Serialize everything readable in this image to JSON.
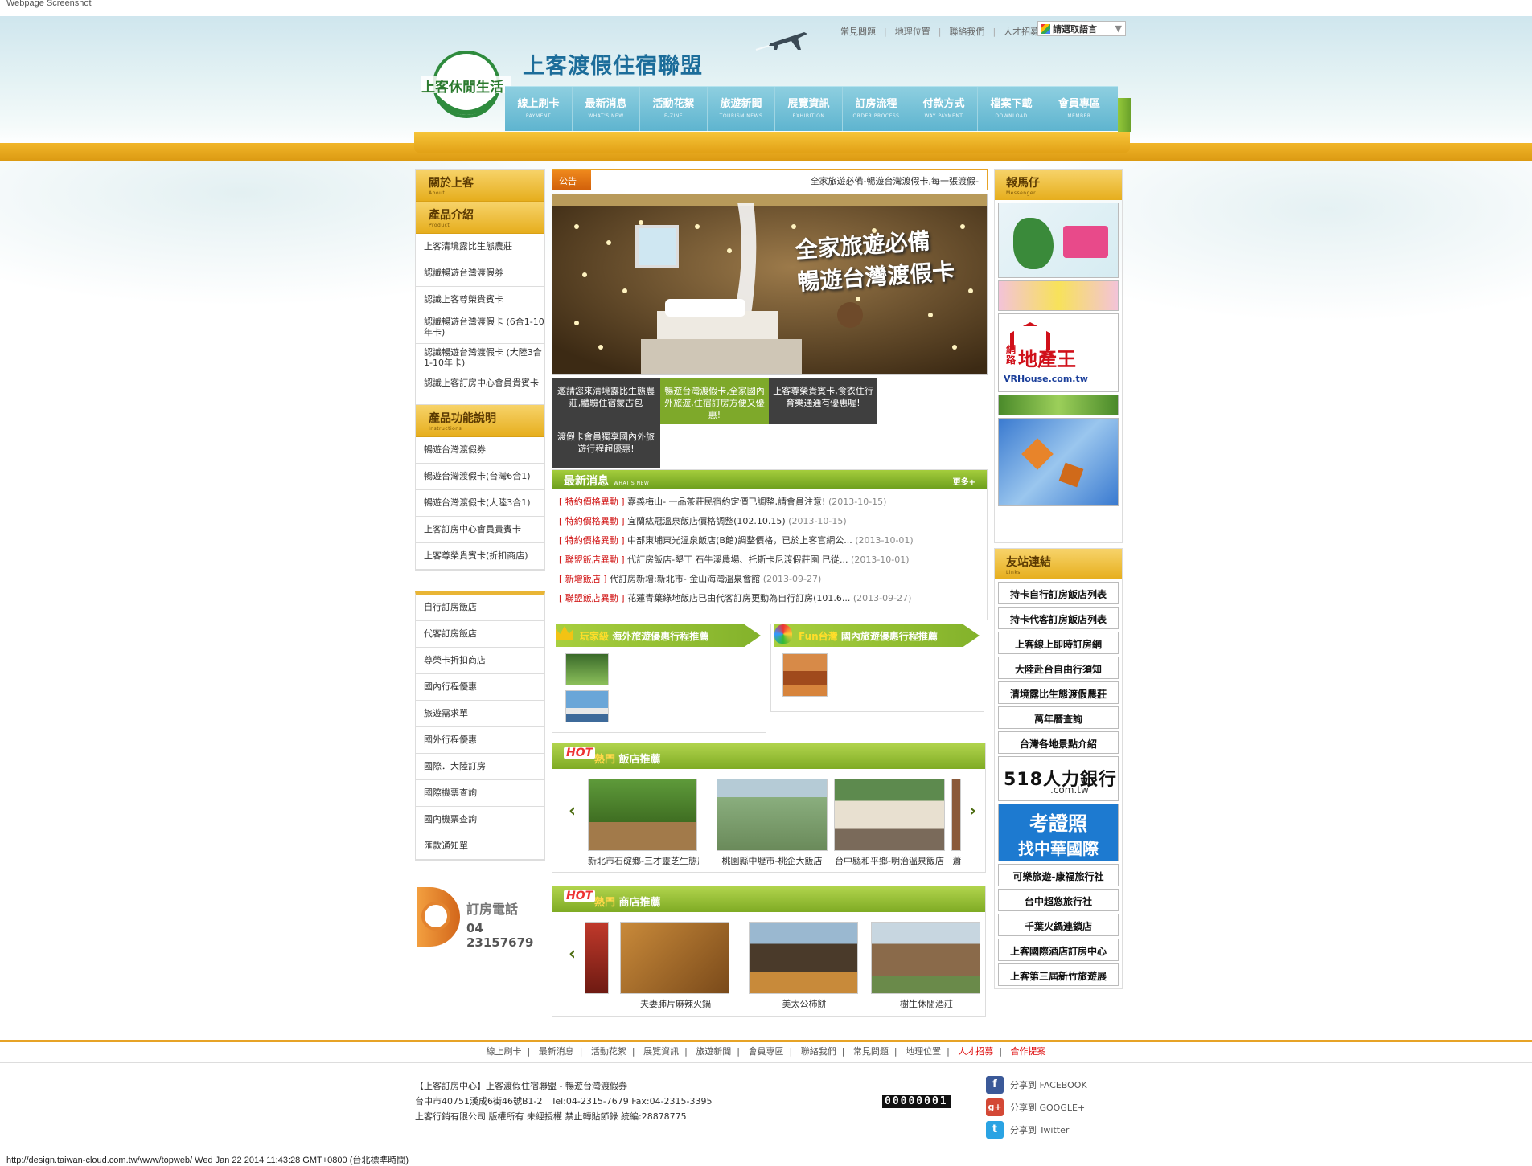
{
  "caption": "Webpage Screenshot",
  "site": {
    "title": "上客渡假住宿聯盟",
    "logo_text": "上客休閒生活"
  },
  "top_links": [
    "常見問題",
    "地理位置",
    "聯絡我們",
    "人才招募"
  ],
  "language_select": "請選取語言",
  "nav": [
    {
      "zh": "線上刷卡",
      "en": "PAYMENT"
    },
    {
      "zh": "最新消息",
      "en": "WHAT'S NEW"
    },
    {
      "zh": "活動花絮",
      "en": "E-ZINE"
    },
    {
      "zh": "旅遊新聞",
      "en": "TOURISM NEWS"
    },
    {
      "zh": "展覽資訊",
      "en": "EXHIBITION"
    },
    {
      "zh": "訂房流程",
      "en": "ORDER PROCESS"
    },
    {
      "zh": "付款方式",
      "en": "WAY PAYMENT"
    },
    {
      "zh": "檔案下載",
      "en": "DOWNLOAD"
    },
    {
      "zh": "會員專區",
      "en": "MEMBER"
    }
  ],
  "left": {
    "about": {
      "zh": "關於上客",
      "en": "About"
    },
    "product": {
      "zh": "產品介紹",
      "en": "Product"
    },
    "product_items": [
      "上客清境露比生態農莊",
      "認識暢遊台灣渡假券",
      "認識上客尊榮貴賓卡",
      "認識暢遊台灣渡假卡 (6合1-10年卡)",
      "認識暢遊台灣渡假卡 (大陸3合1-10年卡)",
      "認識上客訂房中心會員貴賓卡"
    ],
    "instructions": {
      "zh": "產品功能說明",
      "en": "Instructions"
    },
    "instruction_items": [
      "暢遊台灣渡假券",
      "暢遊台灣渡假卡(台灣6合1)",
      "暢遊台灣渡假卡(大陸3合1)",
      "上客訂房中心會員貴賓卡",
      "上客尊榮貴賓卡(折扣商店)"
    ],
    "service_items": [
      "自行訂房飯店",
      "代客訂房飯店",
      "尊榮卡折扣商店",
      "國內行程優惠",
      "旅遊需求單",
      "國外行程優惠",
      "國際．大陸訂房",
      "國際機票查詢",
      "國內機票查詢",
      "匯款通知單"
    ],
    "phone_label": "訂房電話",
    "phone_number": "04 23157679"
  },
  "notice": {
    "tag": "公告",
    "text": "全家旅遊必備-暢遊台灣渡假卡,每一張渡假-"
  },
  "banner": {
    "line1": "全家旅遊必備",
    "line2": "暢遊台灣渡假卡",
    "tiles": [
      "邀請您來清境露比生態農莊,體驗住宿蒙古包",
      "暢遊台灣渡假卡,全家國內外旅遊,住宿訂房方便又優惠!",
      "上客尊榮貴賓卡,食衣住行育樂通通有優惠喔!",
      "渡假卡會員獨享國內外旅遊行程超優惠!"
    ]
  },
  "news": {
    "title": "最新消息",
    "title_en": "WHAT'S NEW",
    "more": "更多+",
    "items": [
      {
        "cat": "[ 特約價格異動 ]",
        "text": "嘉義梅山- 一品茶莊民宿約定價已調整,請會員注意!",
        "date": "(2013-10-15)"
      },
      {
        "cat": "[ 特約價格異動 ]",
        "text": "宜蘭紘冠溫泉飯店價格調整(102.10.15)",
        "date": "(2013-10-15)"
      },
      {
        "cat": "[ 特約價格異動 ]",
        "text": "中部東埔東光溫泉飯店(B館)調整價格，已於上客官網公...",
        "date": "(2013-10-01)"
      },
      {
        "cat": "[ 聯盟飯店異動 ]",
        "text": "代訂房飯店-墾丁 石牛溪農場、托斯卡尼渡假莊園 已從...",
        "date": "(2013-10-01)"
      },
      {
        "cat": "[ 新增飯店 ]",
        "text": "代訂房新增:新北市- 金山海灣溫泉會館",
        "date": "(2013-09-27)"
      },
      {
        "cat": "[ 聯盟飯店異動 ]",
        "text": "花蓮青葉綠地飯店已由代客訂房更動為自行訂房(101.6...",
        "date": "(2013-09-27)"
      }
    ]
  },
  "promo_left": {
    "badge": "玩家級",
    "title": "海外旅遊優惠行程推薦"
  },
  "promo_right": {
    "badge": "Fun台灣",
    "title": "國內旅遊優惠行程推薦"
  },
  "hot_hotels": {
    "badge": "HOT",
    "hot": "熱門",
    "title": "飯店推薦",
    "items": [
      "新北市石碇鄉-三才靈芝生態農場",
      "桃園縣中壢市-桃企大飯店",
      "台中縣和平鄉-明治溫泉飯店",
      "蕭"
    ]
  },
  "hot_shops": {
    "badge": "HOT",
    "hot": "熱門",
    "title": "商店推薦",
    "items": [
      "夫妻肺片麻辣火鍋",
      "美太公柿餅",
      "樹生休閒酒莊"
    ]
  },
  "right": {
    "messenger": {
      "zh": "報馬仔",
      "en": "Messenger"
    },
    "links_head": {
      "zh": "友站連結",
      "en": "Links"
    },
    "links_a": [
      "持卡自行訂房飯店列表",
      "持卡代客訂房飯店列表",
      "上客線上即時訂房網",
      "大陸赴台自由行須知",
      "清境露比生態渡假農莊",
      "萬年曆查詢",
      "台灣各地景點介紹"
    ],
    "ad_518": "518人力銀行",
    "ad_518_url": ".com.tw",
    "ad_exam_line1": "考證照",
    "ad_exam_line2": "找中華國際",
    "ad_house_line1": "網路",
    "ad_house_line2": "地產王",
    "ad_house_url": "VRHouse.com.tw",
    "links_b": [
      "可樂旅遊-康福旅行社",
      "台中超悠旅行社",
      "千葉火鍋連鎖店",
      "上客國際酒店訂房中心",
      "上客第三屆新竹旅遊展"
    ]
  },
  "footer": {
    "nav": [
      "線上刷卡",
      "最新消息",
      "活動花絮",
      "展覽資訊",
      "旅遊新聞",
      "會員專區",
      "聯絡我們",
      "常見問題",
      "地理位置"
    ],
    "nav_red": [
      "人才招募",
      "合作提案"
    ],
    "info1": "【上客訂房中心】上客渡假住宿聯盟 - 暢遊台灣渡假券",
    "info2": "台中市40751漢成6街46號B1-2　Tel:04-2315-7679 Fax:04-2315-3395",
    "info3": "上客行銷有限公司 版權所有 未經授權 禁止轉貼節錄 統編:28878775",
    "counter": "00000001",
    "share": [
      "分享到 FACEBOOK",
      "分享到 GOOGLE+",
      "分享到 Twitter"
    ]
  },
  "status_line": "http://design.taiwan-cloud.com.tw/www/topweb/ Wed Jan 22 2014 11:43:28 GMT+0800 (台北標準時間)"
}
